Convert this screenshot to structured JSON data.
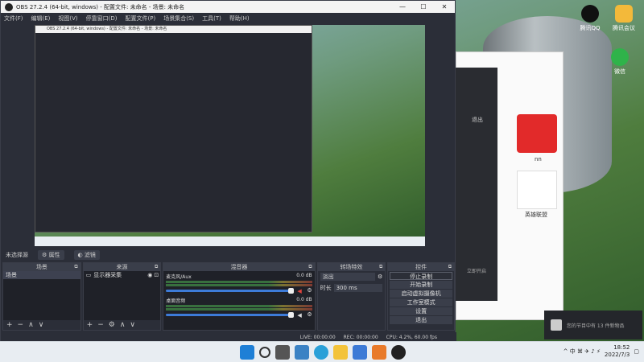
{
  "desktop": {
    "icons": [
      {
        "label": "腾讯QQ",
        "color": "#111"
      },
      {
        "label": "腾讯会议",
        "color": "#f3b93a"
      },
      {
        "label": "微信",
        "color": "#2fb34a"
      }
    ]
  },
  "bg_windows": {
    "dark_button": "退出",
    "dark_button2": "立即开启",
    "game_label_1": "nn",
    "game_label_2": "英雄联盟"
  },
  "obs": {
    "title": "OBS 27.2.4 (64-bit, windows) - 配置文件: 未命名 - 场景: 未命名",
    "window_controls": [
      "—",
      "☐",
      "✕"
    ],
    "menu": [
      "文件(F)",
      "编辑(E)",
      "视图(V)",
      "停靠窗口(D)",
      "配置文件(P)",
      "场景集合(S)",
      "工具(T)",
      "帮助(H)"
    ],
    "no_source": "未选择源",
    "props_button": "属性",
    "filters_button": "滤镜",
    "docks": {
      "scenes": {
        "title": "场景",
        "items": [
          "场景"
        ]
      },
      "sources": {
        "title": "来源",
        "items": [
          "显示器采集"
        ]
      },
      "mixer": {
        "title": "混音器",
        "tracks": [
          {
            "name": "麦克风/Aux",
            "db": "0.0 dB",
            "muted": true
          },
          {
            "name": "桌面音频",
            "db": "0.0 dB",
            "muted": false
          }
        ]
      },
      "transitions": {
        "title": "转场特效",
        "type": "淡出",
        "duration_label": "时长",
        "duration_value": "300 ms"
      },
      "controls": {
        "title": "控件",
        "buttons": [
          "停止录制",
          "开始录制",
          "启动虚拟摄像机",
          "工作室模式",
          "设置",
          "退出"
        ]
      }
    },
    "status": {
      "live": "LIVE: 00:00:00",
      "rec": "REC: 00:00:00",
      "cpu": "CPU: 4.2%, 60.00 fps"
    }
  },
  "toast": {
    "text": "您的节目中有 13 件新物品"
  },
  "taskbar": {
    "tray_icons": "^ 中 ⌘ ✈ ♪ ⚡",
    "time": "18:52",
    "date": "2022/7/3"
  }
}
